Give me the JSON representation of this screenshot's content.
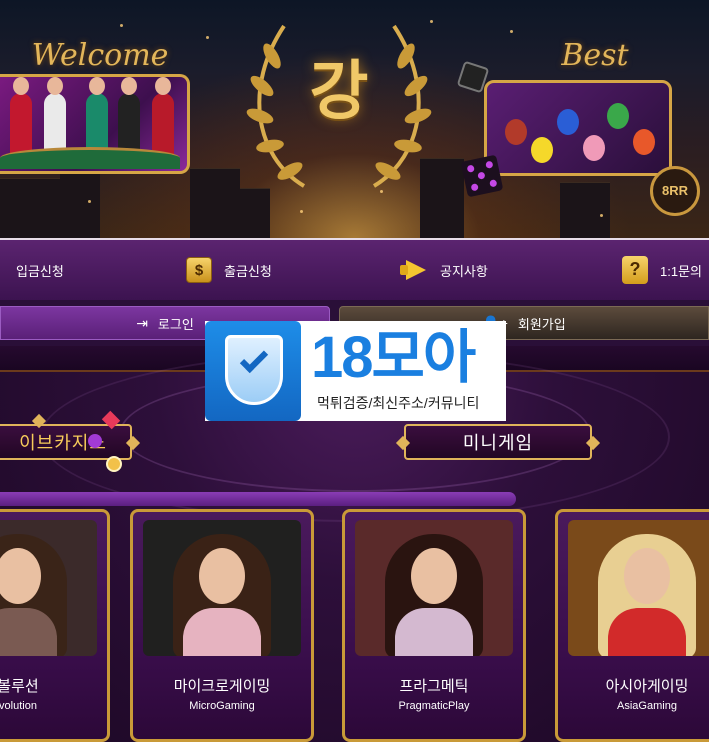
{
  "banner": {
    "welcome_text": "Welcome",
    "best_text": "Best",
    "logo_glyph": "강",
    "slot_text": "8RR"
  },
  "nav": {
    "deposit": "입금신청",
    "withdraw": "출금신청",
    "notice": "공지사항",
    "support": "1:1문의"
  },
  "auth": {
    "login": "로그인",
    "signup": "회원가입"
  },
  "categories": {
    "live": "이브카지노",
    "mini": "미니게임"
  },
  "games": [
    {
      "name": "볼루션",
      "sub": "volution",
      "bg": "#3b2a2a",
      "hair": "#3a2418",
      "outfit": "#7a5a52"
    },
    {
      "name": "마이크로게이밍",
      "sub": "MicroGaming",
      "bg": "#20201f",
      "hair": "#3a2216",
      "outfit": "#e6b3c0"
    },
    {
      "name": "프라그메틱",
      "sub": "PragmaticPlay",
      "bg": "#5a2a2a",
      "hair": "#2a1410",
      "outfit": "#d4b9d0"
    },
    {
      "name": "아시아게이밍",
      "sub": "AsiaGaming",
      "bg": "#7a4a1a",
      "hair": "#e8cf92",
      "outfit": "#d22a2a"
    }
  ],
  "ad": {
    "title": "18모아",
    "subtitle": "먹튀검증/최신주소/커뮤니티"
  },
  "colors": {
    "accent_gold": "#e0b45a",
    "nav_purple": "#5b2470",
    "ad_blue": "#1a7fe0"
  }
}
